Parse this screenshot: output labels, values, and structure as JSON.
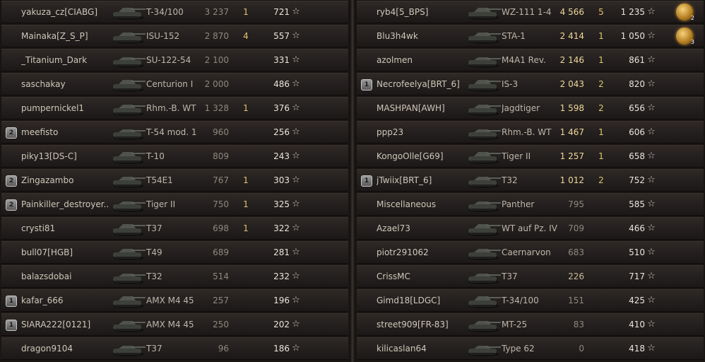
{
  "colors": {
    "panel": "#1a1613",
    "row": "#2a2522",
    "text": "#cfc7b8",
    "frags": "#e3c36e"
  },
  "left_team": [
    {
      "badge": "",
      "name": "yakuza_cz[CIABG]",
      "vehicle": "T-34/100",
      "hp": "3 237",
      "frags": "1",
      "xp": "721"
    },
    {
      "badge": "",
      "name": "Mainaka[Z_S_P]",
      "vehicle": "ISU-152",
      "hp": "2 870",
      "frags": "4",
      "xp": "557"
    },
    {
      "badge": "",
      "name": "_Titanium_Dark",
      "vehicle": "SU-122-54",
      "hp": "2 100",
      "frags": "",
      "xp": "331"
    },
    {
      "badge": "",
      "name": "saschakay",
      "vehicle": "Centurion I",
      "hp": "2 000",
      "frags": "",
      "xp": "486"
    },
    {
      "badge": "",
      "name": "pumpernickel1",
      "vehicle": "Rhm.-B. WT",
      "hp": "1 328",
      "frags": "1",
      "xp": "376"
    },
    {
      "badge": "2",
      "name": "meefisto",
      "vehicle": "T-54 mod. 1",
      "hp": "960",
      "frags": "",
      "xp": "256"
    },
    {
      "badge": "",
      "name": "piky13[DS-C]",
      "vehicle": "T-10",
      "hp": "809",
      "frags": "",
      "xp": "243"
    },
    {
      "badge": "2",
      "name": "Zingazambo",
      "vehicle": "T54E1",
      "hp": "767",
      "frags": "1",
      "xp": "303"
    },
    {
      "badge": "2",
      "name": "Painkiller_destroyer..",
      "vehicle": "Tiger II",
      "hp": "750",
      "frags": "1",
      "xp": "325"
    },
    {
      "badge": "",
      "name": "crysti81",
      "vehicle": "T37",
      "hp": "698",
      "frags": "1",
      "xp": "322"
    },
    {
      "badge": "",
      "name": "bull07[HGB]",
      "vehicle": "T49",
      "hp": "689",
      "frags": "",
      "xp": "281"
    },
    {
      "badge": "",
      "name": "balazsdobai",
      "vehicle": "T32",
      "hp": "514",
      "frags": "",
      "xp": "232"
    },
    {
      "badge": "1",
      "name": "kafar_666",
      "vehicle": "AMX M4 45",
      "hp": "257",
      "frags": "",
      "xp": "196"
    },
    {
      "badge": "1",
      "name": "SIARA222[0121]",
      "vehicle": "AMX M4 45",
      "hp": "250",
      "frags": "",
      "xp": "202"
    },
    {
      "badge": "",
      "name": "dragon9104",
      "vehicle": "T37",
      "hp": "96",
      "frags": "",
      "xp": "186"
    }
  ],
  "right_team": [
    {
      "badge": "",
      "name": "ryb4[5_BPS]",
      "vehicle": "WZ-111 1-4",
      "hp": "4 566",
      "frags": "5",
      "xp": "1 235",
      "medal": "2"
    },
    {
      "badge": "",
      "name": "Blu3h4wk",
      "vehicle": "STA-1",
      "hp": "2 414",
      "frags": "1",
      "xp": "1 050",
      "medal": "3"
    },
    {
      "badge": "",
      "name": "azolmen",
      "vehicle": "M4A1 Rev.",
      "hp": "2 146",
      "frags": "1",
      "xp": "861"
    },
    {
      "badge": "1",
      "name": "Necrofeelya[BRT_6]",
      "vehicle": "IS-3",
      "hp": "2 043",
      "frags": "2",
      "xp": "820"
    },
    {
      "badge": "",
      "name": "MASHPAN[AWH]",
      "vehicle": "Jagdtiger",
      "hp": "1 598",
      "frags": "2",
      "xp": "656"
    },
    {
      "badge": "",
      "name": "ppp23",
      "vehicle": "Rhm.-B. WT",
      "hp": "1 467",
      "frags": "1",
      "xp": "606"
    },
    {
      "badge": "",
      "name": "KongoOlle[G69]",
      "vehicle": "Tiger II",
      "hp": "1 257",
      "frags": "1",
      "xp": "658"
    },
    {
      "badge": "1",
      "name": "jTwiix[BRT_6]",
      "vehicle": "T32",
      "hp": "1 012",
      "frags": "2",
      "xp": "752"
    },
    {
      "badge": "",
      "name": "Miscellaneous",
      "vehicle": "Panther",
      "hp": "795",
      "frags": "",
      "xp": "585"
    },
    {
      "badge": "",
      "name": "Azael73",
      "vehicle": "WT auf Pz. IV",
      "hp": "709",
      "frags": "",
      "xp": "466"
    },
    {
      "badge": "",
      "name": "piotr291062",
      "vehicle": "Caernarvon",
      "hp": "683",
      "frags": "",
      "xp": "510"
    },
    {
      "badge": "",
      "name": "CrissMC",
      "vehicle": "T37",
      "hp": "226",
      "frags": "",
      "xp": "717"
    },
    {
      "badge": "",
      "name": "Gimd18[LDGC]",
      "vehicle": "T-34/100",
      "hp": "151",
      "frags": "",
      "xp": "425"
    },
    {
      "badge": "",
      "name": "street909[FR-83]",
      "vehicle": "MT-25",
      "hp": "83",
      "frags": "",
      "xp": "410"
    },
    {
      "badge": "",
      "name": "kilicaslan64",
      "vehicle": "Type 62",
      "hp": "0",
      "frags": "",
      "xp": "418"
    }
  ]
}
